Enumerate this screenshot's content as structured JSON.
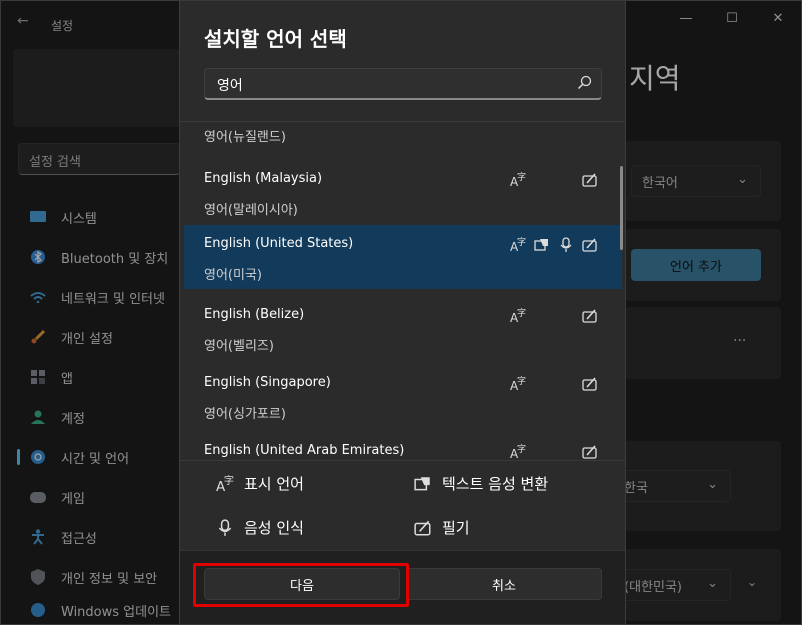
{
  "window": {
    "title": "설정",
    "back": "←",
    "minimize": "—",
    "maximize": "☐",
    "close": "✕"
  },
  "background": {
    "search_placeholder": "설정 검색",
    "heading": "지역",
    "region_select": "한국어",
    "add_language_button": "언어 추가",
    "more": "···",
    "select_2": "한국",
    "select_3": "(대한민국)",
    "nav": [
      {
        "label": "시스템",
        "icon": "monitor-icon"
      },
      {
        "label": "Bluetooth 및 장치",
        "icon": "bluetooth-icon"
      },
      {
        "label": "네트워크 및 인터넷",
        "icon": "wifi-icon"
      },
      {
        "label": "개인 설정",
        "icon": "brush-icon"
      },
      {
        "label": "앱",
        "icon": "apps-icon"
      },
      {
        "label": "계정",
        "icon": "person-icon"
      },
      {
        "label": "시간 및 언어",
        "icon": "globe-clock-icon",
        "active": true
      },
      {
        "label": "게임",
        "icon": "gamepad-icon"
      },
      {
        "label": "접근성",
        "icon": "accessibility-icon"
      },
      {
        "label": "개인 정보 및 보안",
        "icon": "shield-icon"
      },
      {
        "label": "Windows 업데이트",
        "icon": "update-icon"
      }
    ]
  },
  "dialog": {
    "title": "설치할 언어 선택",
    "search_value": "영어",
    "languages": [
      {
        "name": "",
        "sub": "영어(뉴질랜드)",
        "partial": true,
        "features": [
          "display",
          "handwriting"
        ]
      },
      {
        "name": "English (Malaysia)",
        "sub": "영어(말레이시아)",
        "features": [
          "display",
          "handwriting"
        ]
      },
      {
        "name": "English (United States)",
        "sub": "영어(미국)",
        "selected": true,
        "features": [
          "display",
          "tts",
          "speech",
          "handwriting"
        ]
      },
      {
        "name": "English (Belize)",
        "sub": "영어(벨리즈)",
        "features": [
          "display",
          "handwriting"
        ]
      },
      {
        "name": "English (Singapore)",
        "sub": "영어(싱가포르)",
        "features": [
          "display",
          "handwriting"
        ]
      },
      {
        "name": "English (United Arab Emirates)",
        "sub": "",
        "features": [
          "display",
          "handwriting"
        ]
      }
    ],
    "legend": {
      "display": "표시 언어",
      "tts": "텍스트 음성 변환",
      "speech": "음성 인식",
      "handwriting": "필기"
    },
    "next_button": "다음",
    "cancel_button": "취소"
  },
  "colors": {
    "accent": "#60cdff",
    "selected_row": "#123a5a",
    "highlight_box": "#e00000"
  }
}
